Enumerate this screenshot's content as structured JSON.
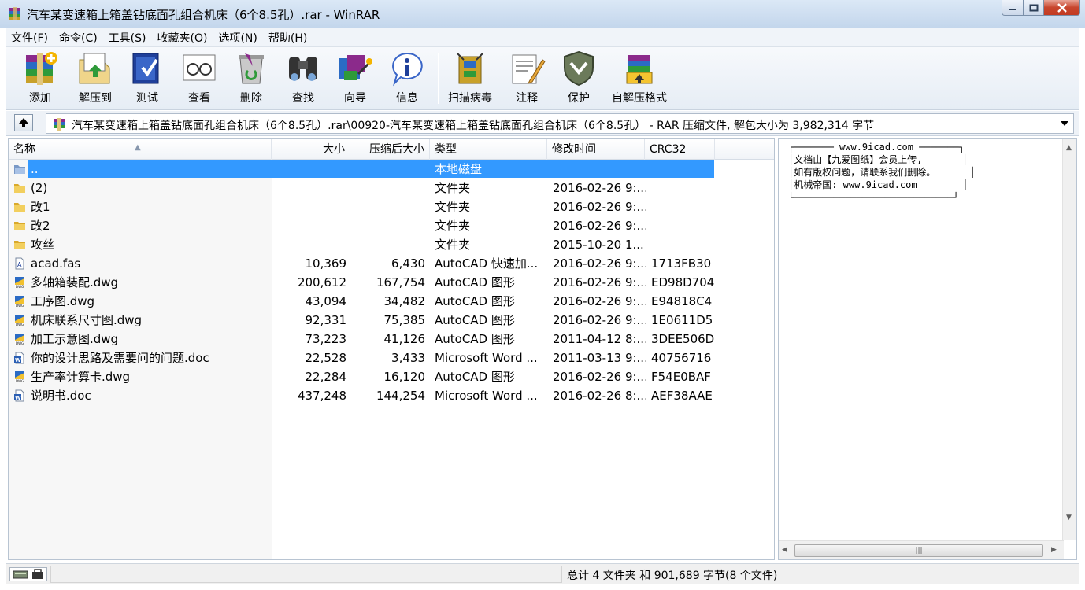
{
  "window": {
    "title": "汽车某变速箱上箱盖钻底面孔组合机床（6个8.5孔）.rar - WinRAR",
    "minimize_glyph": "—",
    "maximize_glyph": "□",
    "close_glyph": "✕"
  },
  "menu": [
    "文件(F)",
    "命令(C)",
    "工具(S)",
    "收藏夹(O)",
    "选项(N)",
    "帮助(H)"
  ],
  "toolbar": {
    "buttons": [
      {
        "label": "添加",
        "icon": "add-archive-icon"
      },
      {
        "label": "解压到",
        "icon": "extract-to-icon"
      },
      {
        "label": "测试",
        "icon": "test-icon"
      },
      {
        "label": "查看",
        "icon": "view-icon"
      },
      {
        "label": "删除",
        "icon": "delete-icon"
      },
      {
        "label": "查找",
        "icon": "find-icon"
      },
      {
        "label": "向导",
        "icon": "wizard-icon"
      },
      {
        "label": "信息",
        "icon": "info-icon"
      },
      {
        "label": "扫描病毒",
        "icon": "virus-scan-icon"
      },
      {
        "label": "注释",
        "icon": "comment-icon"
      },
      {
        "label": "保护",
        "icon": "protect-icon"
      },
      {
        "label": "自解压格式",
        "icon": "sfx-icon"
      }
    ]
  },
  "address": {
    "path": "汽车某变速箱上箱盖钻底面孔组合机床（6个8.5孔）.rar\\00920-汽车某变速箱上箱盖钻底面孔组合机床（6个8.5孔） - RAR 压缩文件, 解包大小为 3,982,314 字节"
  },
  "columns": {
    "name": "名称",
    "size": "大小",
    "packed": "压缩后大小",
    "type": "类型",
    "modified": "修改时间",
    "crc": "CRC32"
  },
  "files": [
    {
      "name": "..",
      "size": "",
      "packed": "",
      "type": "本地磁盘",
      "modified": "",
      "crc": "",
      "icon": "parent-folder-icon",
      "selected": true
    },
    {
      "name": "(2)",
      "size": "",
      "packed": "",
      "type": "文件夹",
      "modified": "2016-02-26 9:...",
      "crc": "",
      "icon": "folder-icon"
    },
    {
      "name": "改1",
      "size": "",
      "packed": "",
      "type": "文件夹",
      "modified": "2016-02-26 9:...",
      "crc": "",
      "icon": "folder-icon"
    },
    {
      "name": "改2",
      "size": "",
      "packed": "",
      "type": "文件夹",
      "modified": "2016-02-26 9:...",
      "crc": "",
      "icon": "folder-icon"
    },
    {
      "name": "攻丝",
      "size": "",
      "packed": "",
      "type": "文件夹",
      "modified": "2015-10-20 1...",
      "crc": "",
      "icon": "folder-icon"
    },
    {
      "name": "acad.fas",
      "size": "10,369",
      "packed": "6,430",
      "type": "AutoCAD 快速加...",
      "modified": "2016-02-26 9:...",
      "crc": "1713FB30",
      "icon": "fas-file-icon"
    },
    {
      "name": "多轴箱装配.dwg",
      "size": "200,612",
      "packed": "167,754",
      "type": "AutoCAD 图形",
      "modified": "2016-02-26 9:...",
      "crc": "ED98D704",
      "icon": "dwg-file-icon"
    },
    {
      "name": "工序图.dwg",
      "size": "43,094",
      "packed": "34,482",
      "type": "AutoCAD 图形",
      "modified": "2016-02-26 9:...",
      "crc": "E94818C4",
      "icon": "dwg-file-icon"
    },
    {
      "name": "机床联系尺寸图.dwg",
      "size": "92,331",
      "packed": "75,385",
      "type": "AutoCAD 图形",
      "modified": "2016-02-26 9:...",
      "crc": "1E0611D5",
      "icon": "dwg-file-icon"
    },
    {
      "name": "加工示意图.dwg",
      "size": "73,223",
      "packed": "41,126",
      "type": "AutoCAD 图形",
      "modified": "2011-04-12 8:...",
      "crc": "3DEE506D",
      "icon": "dwg-file-icon"
    },
    {
      "name": "你的设计思路及需要问的问题.doc",
      "size": "22,528",
      "packed": "3,433",
      "type": "Microsoft Word ...",
      "modified": "2011-03-13 9:...",
      "crc": "40756716",
      "icon": "word-file-icon"
    },
    {
      "name": "生产率计算卡.dwg",
      "size": "22,284",
      "packed": "16,120",
      "type": "AutoCAD 图形",
      "modified": "2016-02-26 9:...",
      "crc": "F54E0BAF",
      "icon": "dwg-file-icon"
    },
    {
      "name": "说明书.doc",
      "size": "437,248",
      "packed": "144,254",
      "type": "Microsoft Word ...",
      "modified": "2016-02-26 8:...",
      "crc": "AEF38AAE",
      "icon": "word-file-icon"
    }
  ],
  "comment": {
    "lines": [
      "┌─────── www.9icad.com ───────┐",
      "│文档由【九爱图纸】会员上传,       │",
      "│如有版权问题，请联系我们删除。      │",
      "│机械帝国: www.9icad.com        │",
      "└────────────────────────────┘"
    ]
  },
  "status": {
    "text": "总计 4 文件夹 和 901,689 字节(8 个文件)"
  },
  "colors": {
    "selection": "#3399ff",
    "titlebar": "#c3d6ec",
    "close_button": "#c8452d"
  }
}
